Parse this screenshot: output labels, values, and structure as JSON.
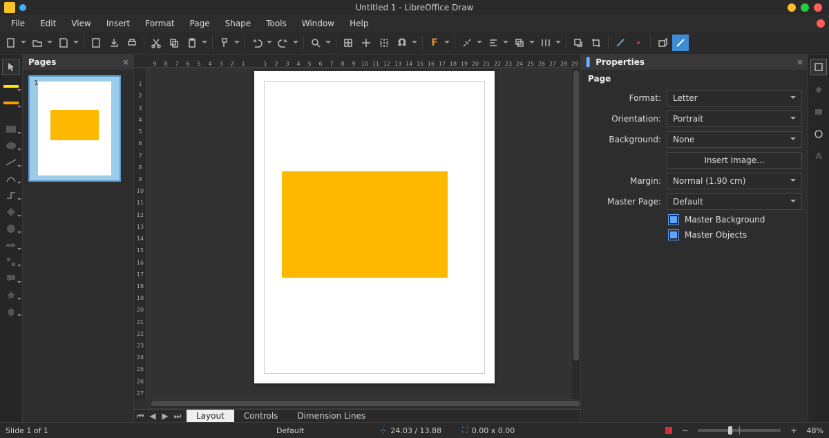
{
  "title": "Untitled 1 - LibreOffice Draw",
  "menus": [
    "File",
    "Edit",
    "View",
    "Insert",
    "Format",
    "Page",
    "Shape",
    "Tools",
    "Window",
    "Help"
  ],
  "pages_panel": {
    "title": "Pages",
    "slide_num": "1"
  },
  "canvas": {
    "shape_fill": "#ffb800"
  },
  "ruler_h": [
    "9",
    "8",
    "7",
    "6",
    "5",
    "4",
    "3",
    "2",
    "1",
    "",
    "1",
    "2",
    "3",
    "4",
    "5",
    "6",
    "7",
    "8",
    "9",
    "10",
    "11",
    "12",
    "13",
    "14",
    "15",
    "16",
    "17",
    "18",
    "19",
    "20",
    "21",
    "22",
    "23",
    "24",
    "25",
    "26",
    "27",
    "28",
    "29"
  ],
  "ruler_v": [
    "",
    "1",
    "2",
    "3",
    "4",
    "5",
    "6",
    "7",
    "8",
    "9",
    "10",
    "11",
    "12",
    "13",
    "14",
    "15",
    "16",
    "17",
    "18",
    "19",
    "20",
    "21",
    "22",
    "23",
    "24",
    "25",
    "26",
    "27"
  ],
  "view_tabs": {
    "layout": "Layout",
    "controls": "Controls",
    "dimension": "Dimension Lines"
  },
  "properties": {
    "title": "Properties",
    "section": "Page",
    "format": {
      "label": "Format:",
      "value": "Letter"
    },
    "orientation": {
      "label": "Orientation:",
      "value": "Portrait"
    },
    "background": {
      "label": "Background:",
      "value": "None"
    },
    "insert_image": "Insert Image...",
    "margin": {
      "label": "Margin:",
      "value": "Normal (1.90 cm)"
    },
    "master_page": {
      "label": "Master Page:",
      "value": "Default"
    },
    "master_background": "Master Background",
    "master_objects": "Master Objects"
  },
  "status": {
    "slide": "Slide 1 of 1",
    "layer": "Default",
    "pos": "24.03 / 13.88",
    "size": "0.00 x 0.00",
    "zoom": "48%"
  }
}
